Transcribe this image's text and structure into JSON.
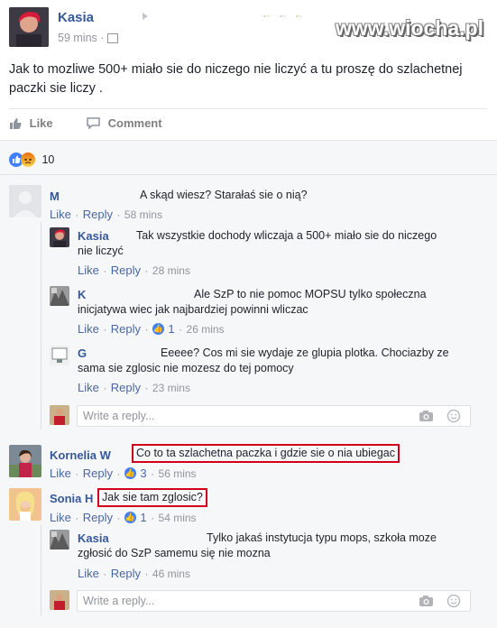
{
  "post": {
    "author": "Kasia",
    "time": "59 mins",
    "text": "Jak to mozliwe 500+ miało sie do niczego nie liczyć a tu proszę do szlachetnej paczki sie liczy .",
    "actions": {
      "like": "Like",
      "comment": "Comment"
    },
    "reaction_count": "10"
  },
  "watermark": "www.wiocha.pl",
  "comments": [
    {
      "author": "M",
      "text": "A skąd wiesz? Starałaś sie o nią?",
      "like": "Like",
      "reply": "Reply",
      "time": "58 mins"
    },
    {
      "author": "Kasia",
      "text": "Tak wszystkie dochody wliczaja a 500+ miało sie do niczego nie liczyć",
      "like": "Like",
      "reply": "Reply",
      "time": "28 mins"
    },
    {
      "author": "K",
      "text": "Ale SzP to nie pomoc MOPSU tylko społeczna inicjatywa wiec jak najbardziej powinni wliczac",
      "like": "Like",
      "reply": "Reply",
      "likes": "1",
      "time": "26 mins"
    },
    {
      "author": "G",
      "text": "Eeeee? Cos mi sie wydaje ze glupia plotka. Chociazby ze sama sie zglosic nie mozesz do tej pomocy",
      "like": "Like",
      "reply": "Reply",
      "time": "23 mins"
    },
    {
      "author": "Kornelia W",
      "text": "Co to ta szlachetna paczka i gdzie sie o nia ubiegac",
      "like": "Like",
      "reply": "Reply",
      "likes": "3",
      "time": "56 mins"
    },
    {
      "author": "Sonia H",
      "text": "Jak sie tam zglosic?",
      "like": "Like",
      "reply": "Reply",
      "likes": "1",
      "time": "54 mins"
    },
    {
      "author": "Kasia",
      "text": "Tylko jakaś instytucja typu mops, szkoła moze zgłosić do SzP samemu się nie mozna",
      "like": "Like",
      "reply": "Reply",
      "time": "46 mins"
    }
  ],
  "reply_placeholder": "Write a reply...",
  "sep": "·",
  "colors": {
    "link": "#365899",
    "highlight": "#d0021b",
    "meta": "#90949c"
  }
}
